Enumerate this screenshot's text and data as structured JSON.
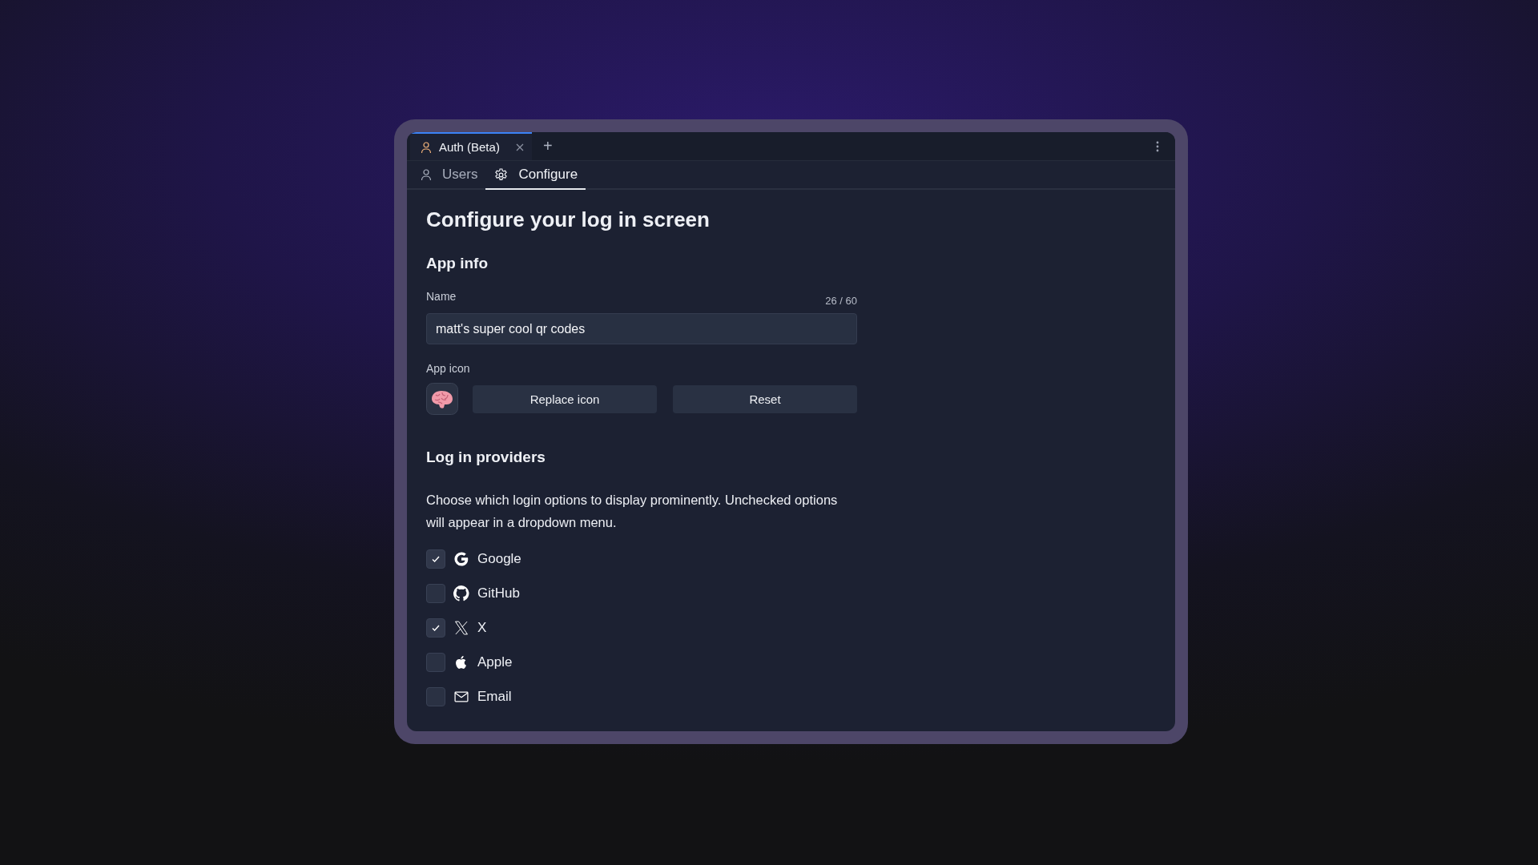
{
  "tabs": [
    {
      "label": "Auth (Beta)",
      "selected": true,
      "kind": "user"
    }
  ],
  "new_tab": "+",
  "subtabs": [
    {
      "label": "Users",
      "selected": false,
      "kind": "user"
    },
    {
      "label": "Configure",
      "selected": true,
      "kind": "gear"
    }
  ],
  "title": "Configure your log in screen",
  "app_info": {
    "heading": "App info",
    "name_label": "Name",
    "counter": "26 / 60",
    "name_value": "matt's super cool qr codes",
    "icon_label": "App icon",
    "buttons": [
      "Replace icon",
      "Reset"
    ]
  },
  "providers": {
    "heading": "Log in providers",
    "description": "Choose which login options to display prominently. Unchecked options will appear in a dropdown menu.",
    "items": [
      {
        "label": "Google",
        "kind": "google",
        "checked": true
      },
      {
        "label": "GitHub",
        "kind": "github",
        "checked": false
      },
      {
        "label": "X",
        "kind": "x",
        "checked": true
      },
      {
        "label": "Apple",
        "kind": "apple",
        "checked": false
      },
      {
        "label": "Email",
        "kind": "email",
        "checked": false
      }
    ]
  }
}
